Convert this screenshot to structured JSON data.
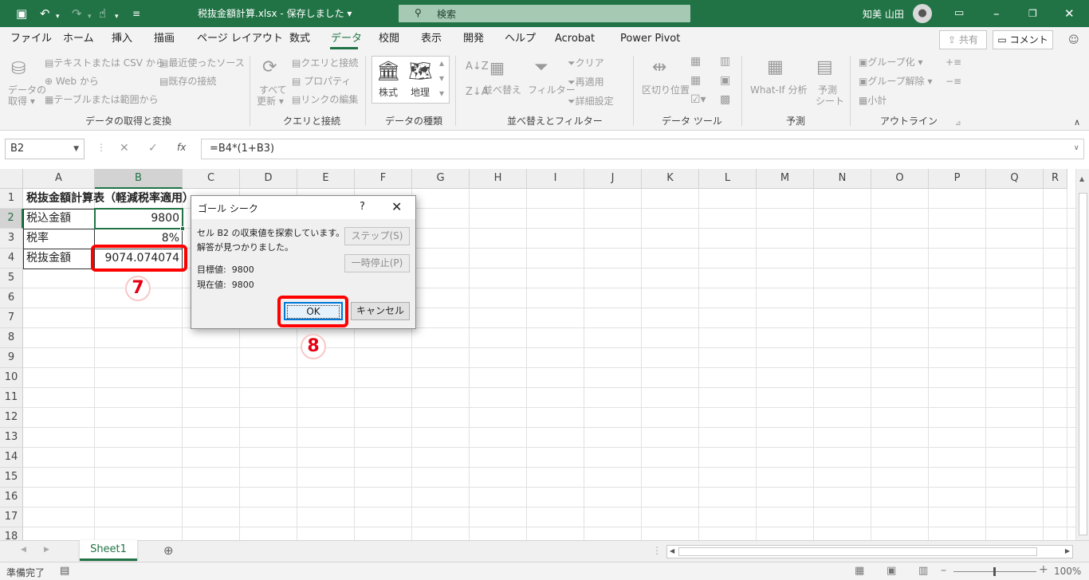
{
  "titlebar": {
    "file_name": "税抜金額計算.xlsx",
    "save_status": "保存しました",
    "search_placeholder": "検索",
    "user_name": "知美 山田",
    "save_icon": "save-icon",
    "undo_icon": "undo-icon",
    "redo_icon": "redo-icon",
    "touch_icon": "touch-mode-icon"
  },
  "menu": {
    "tabs": [
      "ファイル",
      "ホーム",
      "挿入",
      "描画",
      "ページ レイアウト",
      "数式",
      "データ",
      "校閲",
      "表示",
      "開発",
      "ヘルプ",
      "Acrobat",
      "Power Pivot"
    ],
    "active_tab": "データ",
    "share_label": "共有",
    "comment_label": "コメント"
  },
  "ribbon": {
    "get_data": {
      "label1": "データの",
      "label2": "取得 ▾",
      "text_csv": "テキストまたは CSV から",
      "web": "Web から",
      "table_range": "テーブルまたは範囲から",
      "recent": "最近使ったソース",
      "existing": "既存の接続",
      "group_label": "データの取得と変換"
    },
    "queries": {
      "refresh1": "すべて",
      "refresh2": "更新 ▾",
      "queries_conn": "クエリと接続",
      "properties": "プロパティ",
      "edit_links": "リンクの編集",
      "group_label": "クエリと接続"
    },
    "data_types": {
      "stocks": "株式",
      "geography": "地理",
      "group_label": "データの種類"
    },
    "sort_filter": {
      "sort": "並べ替え",
      "filter": "フィルター",
      "clear": "クリア",
      "reapply": "再適用",
      "advanced": "詳細設定",
      "group_label": "並べ替えとフィルター"
    },
    "data_tools": {
      "text_to_columns": "区切り位置",
      "group_label": "データ ツール"
    },
    "forecast": {
      "whatif": "What-If 分析",
      "sheet1": "予測",
      "sheet2": "シート",
      "group_label": "予測"
    },
    "outline": {
      "group": "グループ化",
      "ungroup": "グループ解除",
      "subtotal": "小計",
      "group_label": "アウトライン"
    }
  },
  "formula_bar": {
    "name_box": "B2",
    "formula": "=B4*(1+B3)",
    "fx": "fx"
  },
  "grid": {
    "columns": [
      "A",
      "B",
      "C",
      "D",
      "E",
      "F",
      "G",
      "H",
      "I",
      "J",
      "K",
      "L",
      "M",
      "N",
      "O",
      "P",
      "Q",
      "R"
    ],
    "rows": [
      "1",
      "2",
      "3",
      "4",
      "5",
      "6",
      "7",
      "8",
      "9",
      "10",
      "11",
      "12",
      "13",
      "14",
      "15",
      "16",
      "17",
      "18"
    ],
    "cells": {
      "A1": "税抜金額計算表（軽減税率適用）",
      "A2": "税込金額",
      "B2": "9800",
      "A3": "税率",
      "B3": "8%",
      "A4": "税抜金額",
      "B4": "9074.074074"
    }
  },
  "dialog": {
    "title": "ゴール シーク",
    "help": "?",
    "message1": "セル B2 の収束値を探索しています。",
    "message2": "解答が見つかりました。",
    "target_label": "目標値:",
    "target_value": "9800",
    "current_label": "現在値:",
    "current_value": "9800",
    "step_button": "ステップ(S)",
    "pause_button": "一時停止(P)",
    "ok_button": "OK",
    "cancel_button": "キャンセル"
  },
  "annotations": {
    "badge7": "7",
    "badge8": "8",
    "highlight_color": "#ff0000"
  },
  "sheets": {
    "active": "Sheet1"
  },
  "status": {
    "ready": "準備完了",
    "zoom": "100%"
  },
  "colors": {
    "accent": "#217346"
  }
}
